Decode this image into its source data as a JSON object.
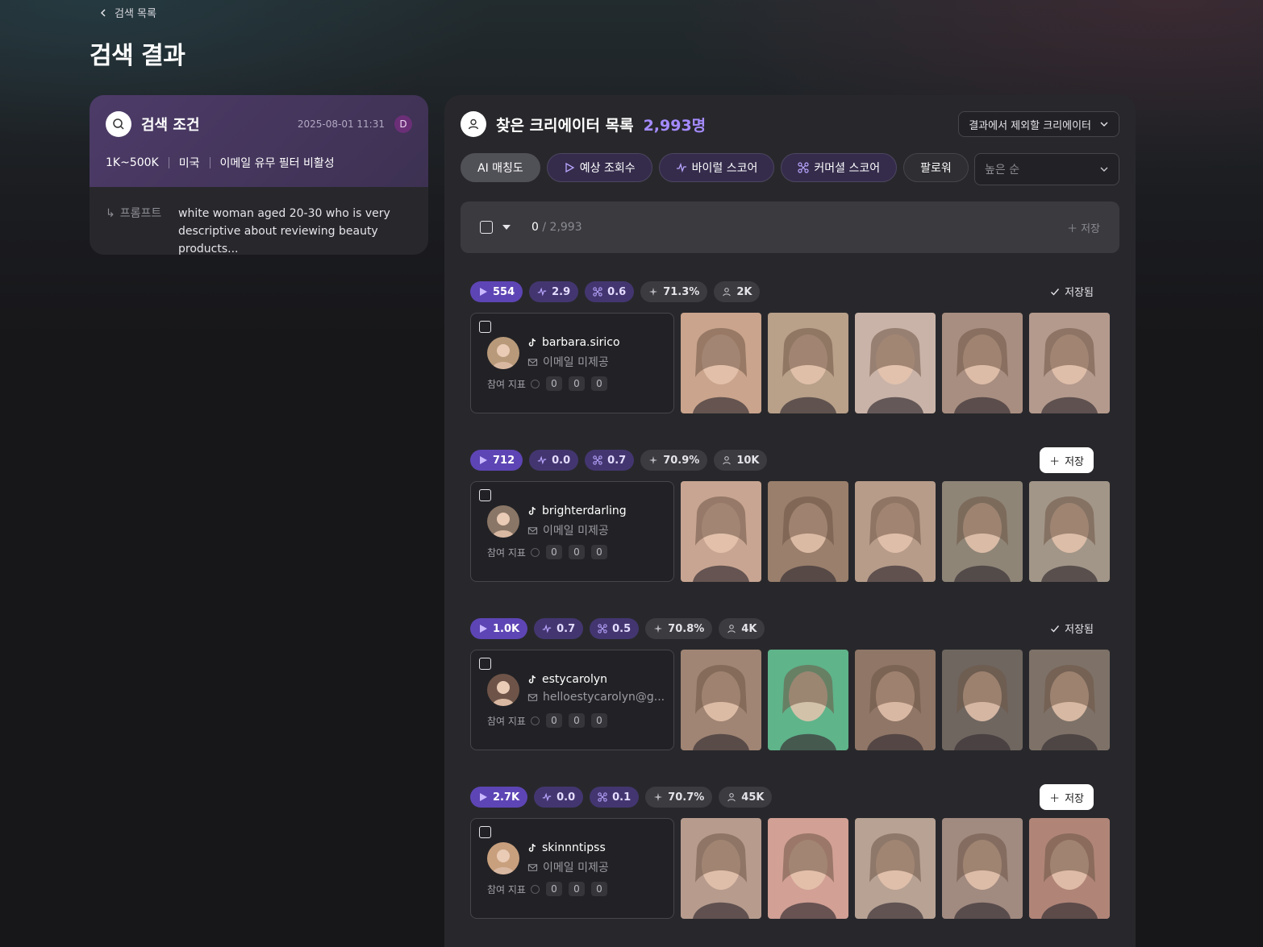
{
  "nav": {
    "back_label": "검색 목록"
  },
  "page": {
    "title": "검색 결과"
  },
  "conditions": {
    "title": "검색 조건",
    "date": "2025-08-01 11:31",
    "user_initial": "D",
    "filters": [
      "1K~500K",
      "미국",
      "이메일 유무 필터 비활성"
    ],
    "prompt_label": "프롬프트",
    "prompt_line1": "white woman aged 20-30 who is very",
    "prompt_line2": "descriptive about reviewing beauty products..."
  },
  "results": {
    "title": "찾은 크리에이터 목록",
    "count": "2,993명",
    "exclude_label": "결과에서 제외할 크리에이터",
    "tabs": [
      {
        "label": "AI 매칭도",
        "icon": ""
      },
      {
        "label": "예상 조회수",
        "icon": "play-outline-icon"
      },
      {
        "label": "바이럴 스코어",
        "icon": "pulse-icon"
      },
      {
        "label": "커머셜 스코어",
        "icon": "network-icon"
      },
      {
        "label": "팔로워",
        "icon": ""
      }
    ],
    "sort_placeholder": "높은 순",
    "selected": "0",
    "total": "/ 2,993",
    "save_label": "저장"
  },
  "labels": {
    "saved": "저장됨",
    "save": "저장",
    "engagement": "참여 지표"
  },
  "creators": [
    {
      "stats": {
        "views": "554",
        "viral": "2.9",
        "commercial": "0.6",
        "match": "71.3%",
        "followers": "2K"
      },
      "state": "saved",
      "name": "barbara.sirico",
      "email": "이메일 미제공",
      "metrics": [
        "0",
        "0",
        "0"
      ],
      "avatar_color": "#b89a7a",
      "thumbs": [
        "#caa48c",
        "#b8a089",
        "#c9b3a8",
        "#a88e80",
        "#b49a8d"
      ]
    },
    {
      "stats": {
        "views": "712",
        "viral": "0.0",
        "commercial": "0.7",
        "match": "70.9%",
        "followers": "10K"
      },
      "state": "save",
      "name": "brighterdarling",
      "email": "이메일 미제공",
      "metrics": [
        "0",
        "0",
        "0"
      ],
      "avatar_color": "#8a7666",
      "thumbs": [
        "#c8a592",
        "#9a7f6c",
        "#b79c8a",
        "#8e8577",
        "#a29688"
      ]
    },
    {
      "stats": {
        "views": "1.0K",
        "viral": "0.7",
        "commercial": "0.5",
        "match": "70.8%",
        "followers": "4K"
      },
      "state": "saved",
      "name": "estycarolyn",
      "email": "helloestycarolyn@g...",
      "metrics": [
        "0",
        "0",
        "0"
      ],
      "avatar_color": "#6e5448",
      "thumbs": [
        "#a08574",
        "#5fb48a",
        "#8f7667",
        "#6f6660",
        "#7e7268"
      ]
    },
    {
      "stats": {
        "views": "2.7K",
        "viral": "0.0",
        "commercial": "0.1",
        "match": "70.7%",
        "followers": "45K"
      },
      "state": "save",
      "name": "skinnntipss",
      "email": "이메일 미제공",
      "metrics": [
        "0",
        "0",
        "0"
      ],
      "avatar_color": "#c9a07e",
      "thumbs": [
        "#b79c8e",
        "#d2a095",
        "#b7a294",
        "#a18a80",
        "#b08578"
      ]
    }
  ]
}
